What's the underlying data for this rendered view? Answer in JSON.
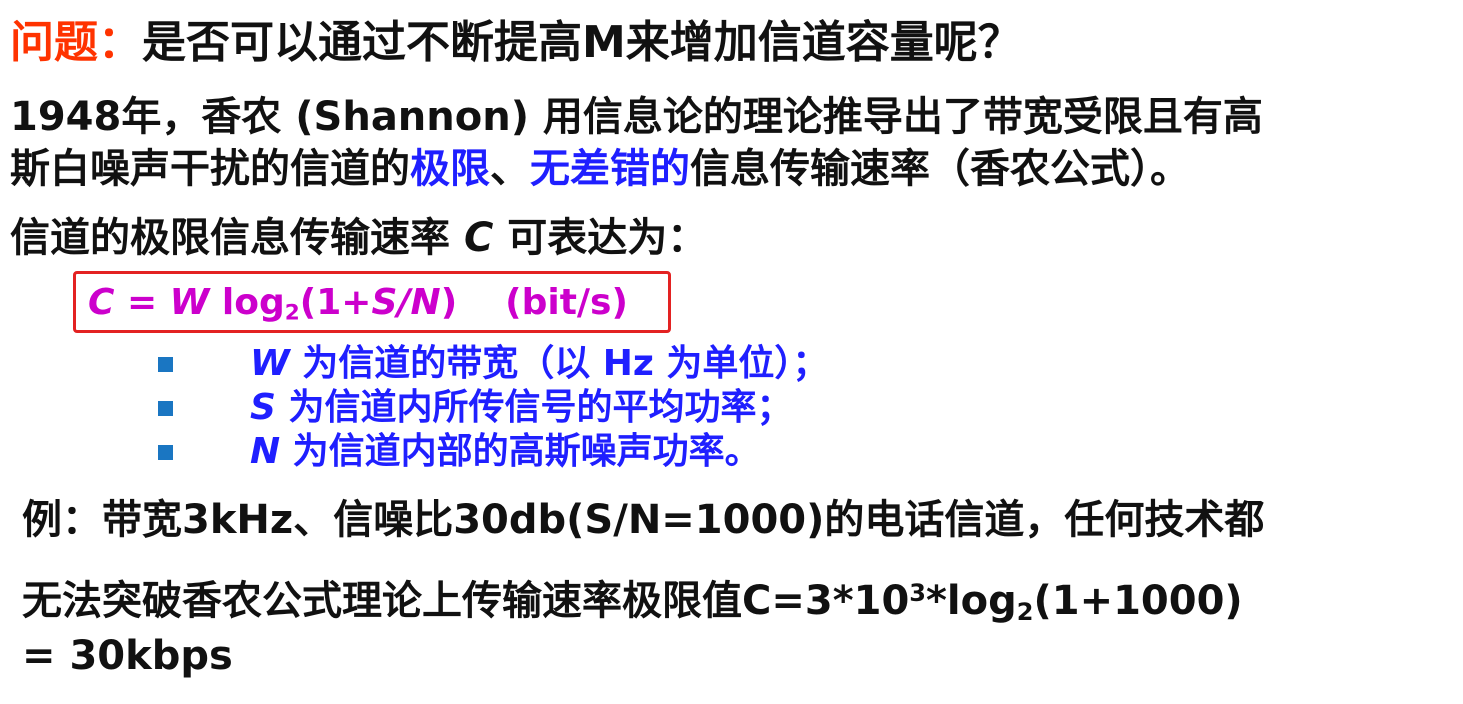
{
  "title": {
    "label": "问题：",
    "text": "是否可以通过不断提高M来增加信道容量呢？"
  },
  "para1": {
    "line1": "1948年，香农 (Shannon) 用信息论的理论推导出了带宽受限且有高",
    "line2_pre": "斯白噪声干扰的信道的",
    "line2_blue1": "极限",
    "line2_sep": "、",
    "line2_blue2": "无差错的",
    "line2_post": "信息传输速率（香农公式）。"
  },
  "para2": {
    "text": "信道的极限信息传输速率 ",
    "var": "C",
    "tail": " 可表达为："
  },
  "formula": {
    "lhs": "C",
    "eq": " = ",
    "w": "W",
    "log": " log",
    "base": "2",
    "open": "(1+",
    "s": "S",
    "slash": "/",
    "n": "N",
    "close": ")",
    "unit": "(bit/s)"
  },
  "bullets": [
    {
      "var": "W",
      "text": " 为信道的带宽（以 Hz 为单位）；"
    },
    {
      "var": "S",
      "text": " 为信道内所传信号的平均功率；"
    },
    {
      "var": "N",
      "text": " 为信道内部的高斯噪声功率。"
    }
  ],
  "example": {
    "line1": "例：带宽3kHz、信噪比30db(S/N=1000)的电话信道，任何技术都",
    "line2_a": "无法突破香农公式理论上传输速率极限值C=3*10",
    "line2_exp": "3",
    "line2_b": "*log",
    "line2_base": "2",
    "line2_c": "(1+1000)",
    "line3": "= 30kbps"
  },
  "colors": {
    "label_red": "#ff3300",
    "highlight_blue": "#1f1fff",
    "formula_magenta": "#cc00cc",
    "box_red": "#e32222",
    "bullet_blue": "#1a76c2"
  }
}
